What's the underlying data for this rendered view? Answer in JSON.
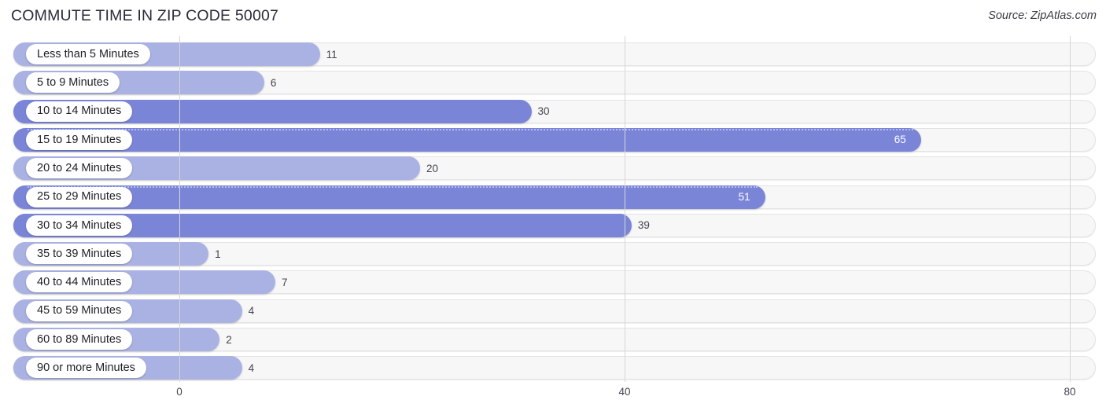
{
  "header": {
    "title": "COMMUTE TIME IN ZIP CODE 50007",
    "source": "Source: ZipAtlas.com"
  },
  "colors": {
    "bar_light": "#aab2e3",
    "bar_dark": "#7b85d8",
    "track": "#f7f7f7",
    "gridline": "#d6d6d6",
    "text": "#44444f"
  },
  "chart_data": {
    "type": "bar",
    "orientation": "horizontal",
    "title": "COMMUTE TIME IN ZIP CODE 50007",
    "xlabel": "",
    "ylabel": "",
    "xlim": [
      0,
      80
    ],
    "grid": true,
    "legend": "none",
    "ticks": [
      "0",
      "40",
      "80"
    ],
    "tick_values": [
      0,
      40,
      80
    ],
    "categories": [
      "Less than 5 Minutes",
      "5 to 9 Minutes",
      "10 to 14 Minutes",
      "15 to 19 Minutes",
      "20 to 24 Minutes",
      "25 to 29 Minutes",
      "30 to 34 Minutes",
      "35 to 39 Minutes",
      "40 to 44 Minutes",
      "45 to 59 Minutes",
      "60 to 89 Minutes",
      "90 or more Minutes"
    ],
    "values": [
      11,
      6,
      30,
      65,
      20,
      51,
      39,
      1,
      7,
      4,
      2,
      4
    ],
    "labels": [
      "11",
      "6",
      "30",
      "65",
      "20",
      "51",
      "39",
      "1",
      "7",
      "4",
      "2",
      "4"
    ]
  },
  "rows": [
    {
      "label": "Less than 5 Minutes",
      "value": 11,
      "value_label": "11",
      "dark": false,
      "inside": false
    },
    {
      "label": "5 to 9 Minutes",
      "value": 6,
      "value_label": "6",
      "dark": false,
      "inside": false
    },
    {
      "label": "10 to 14 Minutes",
      "value": 30,
      "value_label": "30",
      "dark": true,
      "inside": false
    },
    {
      "label": "15 to 19 Minutes",
      "value": 65,
      "value_label": "65",
      "dark": true,
      "inside": true
    },
    {
      "label": "20 to 24 Minutes",
      "value": 20,
      "value_label": "20",
      "dark": false,
      "inside": false
    },
    {
      "label": "25 to 29 Minutes",
      "value": 51,
      "value_label": "51",
      "dark": true,
      "inside": true
    },
    {
      "label": "30 to 34 Minutes",
      "value": 39,
      "value_label": "39",
      "dark": true,
      "inside": false
    },
    {
      "label": "35 to 39 Minutes",
      "value": 1,
      "value_label": "1",
      "dark": false,
      "inside": false
    },
    {
      "label": "40 to 44 Minutes",
      "value": 7,
      "value_label": "7",
      "dark": false,
      "inside": false
    },
    {
      "label": "45 to 59 Minutes",
      "value": 4,
      "value_label": "4",
      "dark": false,
      "inside": false
    },
    {
      "label": "60 to 89 Minutes",
      "value": 2,
      "value_label": "2",
      "dark": false,
      "inside": false
    },
    {
      "label": "90 or more Minutes",
      "value": 4,
      "value_label": "4",
      "dark": false,
      "inside": false
    }
  ]
}
